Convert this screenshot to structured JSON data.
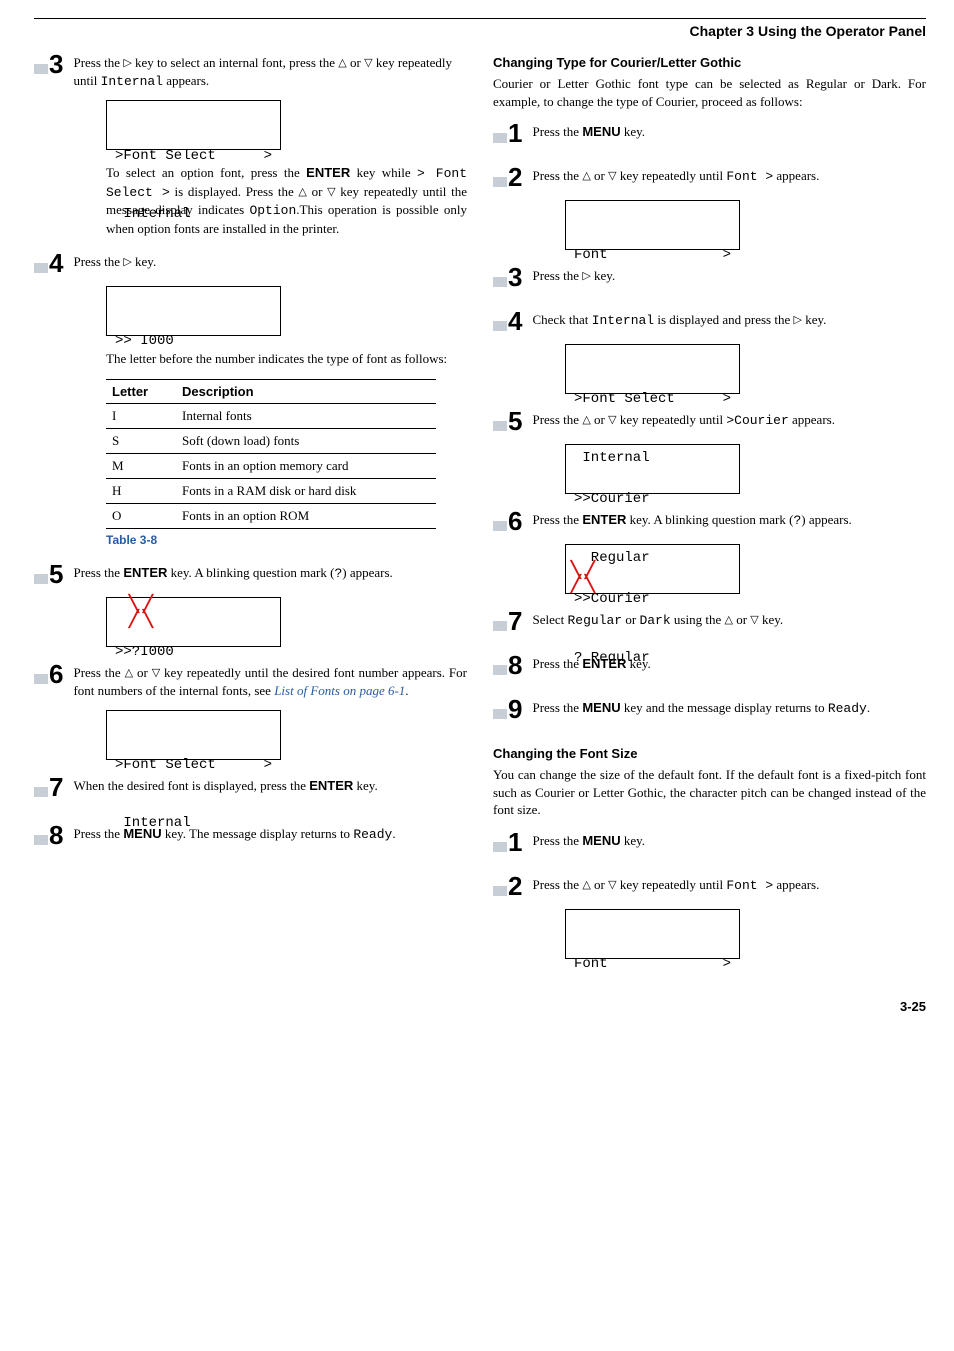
{
  "header": {
    "chapter_title": "Chapter 3  Using the Operator Panel"
  },
  "page_number": "3-25",
  "left": {
    "step3": {
      "num": "3",
      "text_a": "Press the ",
      "tri1": "▷",
      "text_b": " key to select an internal font, press the ",
      "tri2": "△",
      "text_c": " or ",
      "tri3": "▽",
      "text_d": " key repeatedly until ",
      "mono": "Internal",
      "text_e": " appears.",
      "lcd_line1_left": ">Font Select",
      "lcd_line1_right": ">",
      "lcd_line2": " Internal",
      "para2_a": "To select an option font, press the ",
      "para2_enter": "ENTER",
      "para2_b": " key while ",
      "para2_mono1": "> Font  Select  >",
      "para2_c": " is displayed. Press the ",
      "para2_tri1": "△",
      "para2_d": " or ",
      "para2_tri2": "▽",
      "para2_e": " key repeatedly until the message display indicates ",
      "para2_mono2": "Option",
      "para2_f": ".This operation is possible only when option fonts are installed in the printer."
    },
    "step4": {
      "num": "4",
      "text_a": "Press the ",
      "tri": "▷",
      "text_b": " key.",
      "lcd_line1": ">> I000",
      "para_below": "The letter before the number indicates the type of font as follows:"
    },
    "table": {
      "head_letter": "Letter",
      "head_desc": "Description",
      "rows": [
        {
          "l": "I",
          "d": "Internal fonts"
        },
        {
          "l": "S",
          "d": "Soft (down load) fonts"
        },
        {
          "l": "M",
          "d": "Fonts in an option memory card"
        },
        {
          "l": "H",
          "d": "Fonts in a RAM disk or hard disk"
        },
        {
          "l": "O",
          "d": "Fonts in an option ROM"
        }
      ],
      "caption": "Table 3-8"
    },
    "step5": {
      "num": "5",
      "text_a": "Press the ",
      "enter": "ENTER",
      "text_b": " key. A blinking question mark (",
      "mono": "?",
      "text_c": ") appears.",
      "lcd_line1": ">>?I000"
    },
    "step6": {
      "num": "6",
      "text_a": "Press the ",
      "tri1": "△",
      "text_b": " or ",
      "tri2": "▽",
      "text_c": " key repeatedly until the desired font number appears. For font numbers of the internal fonts, see ",
      "link": "List of Fonts on page 6-1",
      "text_d": ".",
      "lcd_line1_left": ">Font Select",
      "lcd_line1_right": ">",
      "lcd_line2": " Internal"
    },
    "step7": {
      "num": "7",
      "text_a": "When the desired font is displayed, press the ",
      "enter": "ENTER",
      "text_b": " key."
    },
    "step8": {
      "num": "8",
      "text_a": "Press the ",
      "menu": "MENU",
      "text_b": " key. The message display returns to ",
      "mono": "Ready",
      "text_c": "."
    }
  },
  "right": {
    "section1_title": "Changing Type for Courier/Letter Gothic",
    "section1_intro": "Courier or Letter Gothic font type can be selected as Regular or Dark. For example, to change the type of Courier, proceed as follows:",
    "r_step1": {
      "num": "1",
      "text_a": "Press the ",
      "menu": "MENU",
      "text_b": " key."
    },
    "r_step2": {
      "num": "2",
      "text_a": "Press the ",
      "tri1": "△",
      "text_b": " or ",
      "tri2": "▽",
      "text_c": " key repeatedly until ",
      "mono": "Font  >",
      "text_d": " appears.",
      "lcd_left": "Font",
      "lcd_right": ">"
    },
    "r_step3": {
      "num": "3",
      "text_a": "Press the ",
      "tri": "▷",
      "text_b": " key."
    },
    "r_step4": {
      "num": "4",
      "text_a": "Check that ",
      "mono": "Internal",
      "text_b": " is displayed and press the ",
      "tri": "▷",
      "text_c": " key.",
      "lcd_line1_left": ">Font Select",
      "lcd_line1_right": ">",
      "lcd_line2": " Internal"
    },
    "r_step5": {
      "num": "5",
      "text_a": "Press the ",
      "tri1": "△",
      "text_b": " or ",
      "tri2": "▽",
      "text_c": " key repeatedly until ",
      "mono": ">Courier",
      "text_d": " appears.",
      "lcd_line1": ">>Courier",
      "lcd_line2": "  Regular"
    },
    "r_step6": {
      "num": "6",
      "text_a": "Press the ",
      "enter": "ENTER",
      "text_b": " key. A blinking question mark (",
      "mono": "?",
      "text_c": ") appears.",
      "lcd_line1": ">>Courier",
      "lcd_line2": "? Regular"
    },
    "r_step7": {
      "num": "7",
      "text_a": "Select ",
      "mono1": "Regular",
      "text_b": " or ",
      "mono2": "Dark",
      "text_c": " using the ",
      "tri1": "△",
      "text_d": " or ",
      "tri2": "▽",
      "text_e": " key."
    },
    "r_step8": {
      "num": "8",
      "text_a": "Press the ",
      "enter": "ENTER",
      "text_b": " key."
    },
    "r_step9": {
      "num": "9",
      "text_a": "Press the ",
      "menu": "MENU",
      "text_b": " key and the message display returns to ",
      "mono": "Ready",
      "text_c": "."
    },
    "section2_title": "Changing the Font Size",
    "section2_intro": "You can change the size of the default font. If the default font is a fixed-pitch font such as Courier or Letter Gothic, the character pitch can be changed instead of the font size.",
    "s2_step1": {
      "num": "1",
      "text_a": "Press the ",
      "menu": "MENU",
      "text_b": " key."
    },
    "s2_step2": {
      "num": "2",
      "text_a": "Press the ",
      "tri1": "△",
      "text_b": " or ",
      "tri2": "▽",
      "text_c": " key repeatedly until ",
      "mono": "Font  >",
      "text_d": " appears.",
      "lcd_left": "Font",
      "lcd_right": ">"
    }
  }
}
